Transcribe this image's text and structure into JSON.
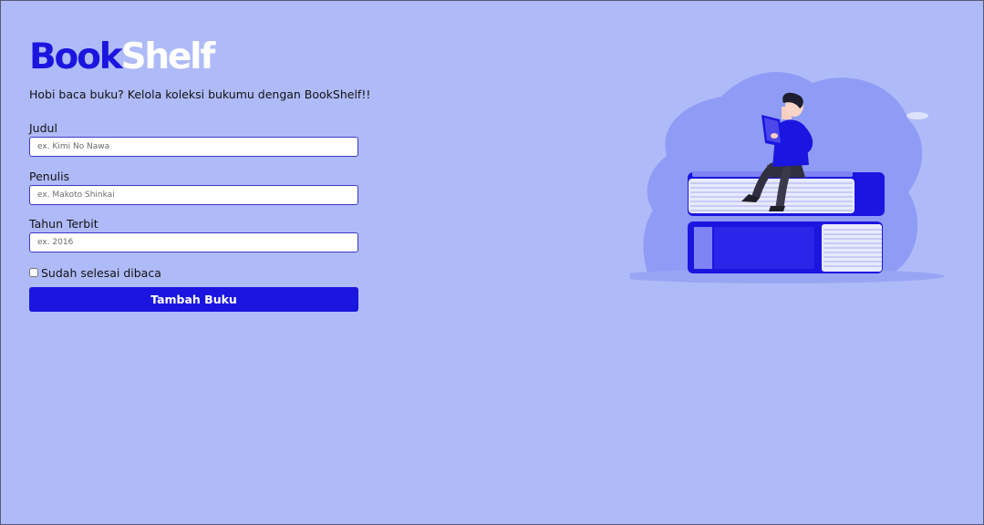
{
  "brand": {
    "part1": "Book",
    "part2": "Shelf"
  },
  "tagline": "Hobi baca buku? Kelola koleksi bukumu dengan BookShelf!!",
  "form": {
    "title_label": "Judul",
    "title_placeholder": "ex. Kimi No Nawa",
    "author_label": "Penulis",
    "author_placeholder": "ex. Makoto Shinkai",
    "year_label": "Tahun Terbit",
    "year_placeholder": "ex. 2016",
    "finished_label": "Sudah selesai dibaca",
    "finished_checked": false,
    "submit_label": "Tambah Buku"
  },
  "colors": {
    "background": "#afbbf8",
    "accent": "#1b15e0",
    "input_border": "#3d38c8"
  },
  "illustration": {
    "icon": "person-reading-on-books-illustration"
  }
}
